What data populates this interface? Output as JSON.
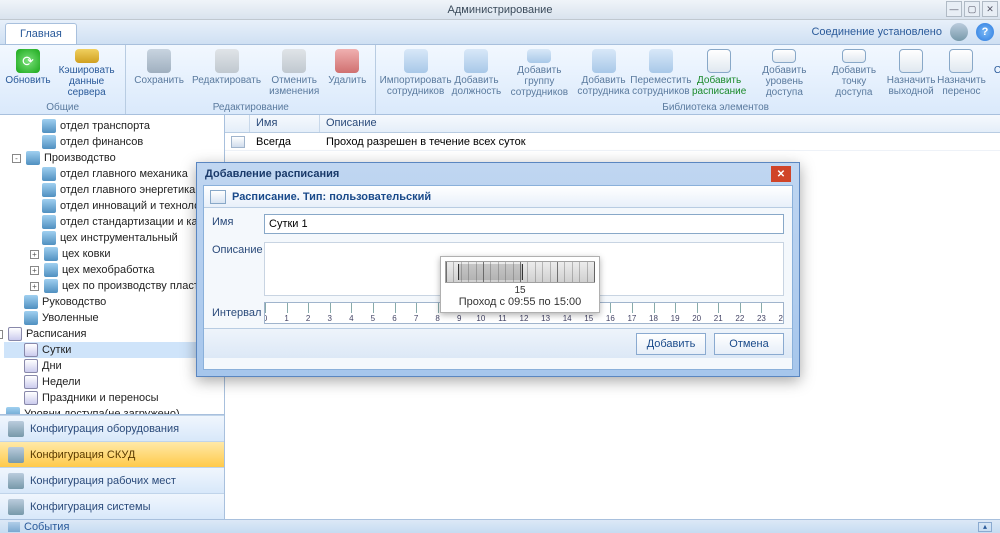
{
  "window": {
    "title": "Администрирование"
  },
  "tabs": {
    "main": "Главная"
  },
  "connection": {
    "status": "Соединение установлено"
  },
  "ribbon": {
    "groups": {
      "common": "Общие",
      "editing": "Редактирование",
      "library": "Библиотека элементов"
    },
    "buttons": {
      "refresh": "Обновить",
      "cache": "Кэшировать\nданные сервера",
      "save": "Сохранить",
      "edit": "Редактировать",
      "undo": "Отменить\nизменения",
      "delete": "Удалить",
      "import": "Импортировать\nсотрудников",
      "addPosition": "Добавить\nдолжность",
      "addGroup": "Добавить группу\nсотрудников",
      "addEmployee": "Добавить\nсотрудника",
      "moveEmployee": "Переместить\nсотрудников",
      "addSchedule": "Добавить\nрасписание",
      "addAccessLevel": "Добавить\nуровень доступа",
      "addAccessPoint": "Добавить\nточку доступа",
      "setDayOff": "Назначить\nвыходной",
      "setTransfer": "Назначить\nперенос",
      "apState": "Состояние\nточек доступа"
    }
  },
  "tree": {
    "items": [
      {
        "label": "отдел транспорта",
        "indent": 1,
        "icon": "ppl"
      },
      {
        "label": "отдел финансов",
        "indent": 1,
        "icon": "ppl"
      },
      {
        "label": "Производство",
        "indent": 0,
        "icon": "ppl",
        "exp": "-"
      },
      {
        "label": "отдел главного механика",
        "indent": 1,
        "icon": "ppl"
      },
      {
        "label": "отдел главного энергетика",
        "indent": 1,
        "icon": "ppl"
      },
      {
        "label": "отдел инноваций и технологи",
        "indent": 1,
        "icon": "ppl"
      },
      {
        "label": "отдел стандартизации и каче",
        "indent": 1,
        "icon": "ppl"
      },
      {
        "label": "цех инструментальный",
        "indent": 1,
        "icon": "ppl"
      },
      {
        "label": "цех ковки",
        "indent": 1,
        "icon": "ppl",
        "exp": "+"
      },
      {
        "label": "цех мехобработка",
        "indent": 1,
        "icon": "ppl",
        "exp": "+"
      },
      {
        "label": "цех по производству пластик",
        "indent": 1,
        "icon": "ppl",
        "exp": "+"
      },
      {
        "label": "Руководство",
        "indent": 0,
        "icon": "ppl"
      },
      {
        "label": "Уволенные",
        "indent": 0,
        "icon": "ppl"
      },
      {
        "label": "Расписания",
        "indent": -1,
        "icon": "cal",
        "exp": "-"
      },
      {
        "label": "Сутки",
        "indent": 0,
        "icon": "cal",
        "sel": true
      },
      {
        "label": "Дни",
        "indent": 0,
        "icon": "cal"
      },
      {
        "label": "Недели",
        "indent": 0,
        "icon": "cal"
      },
      {
        "label": "Праздники и переносы",
        "indent": 0,
        "icon": "cal"
      },
      {
        "label": "Уровни доступа(не загружено)",
        "indent": -1,
        "icon": "ppl"
      }
    ]
  },
  "nav": {
    "hardware": "Конфигурация оборудования",
    "skud": "Конфигурация СКУД",
    "workplaces": "Конфигурация рабочих мест",
    "system": "Конфигурация системы"
  },
  "grid": {
    "colName": "Имя",
    "colDesc": "Описание",
    "row": {
      "name": "Всегда",
      "desc": "Проход разрешен в течение всех суток"
    }
  },
  "dialog": {
    "title": "Добавление расписания",
    "header": "Расписание.  Тип: пользовательский",
    "labelName": "Имя",
    "valueName": "Сутки 1",
    "labelDesc": "Описание",
    "labelInterval": "Интервал",
    "btnAdd": "Добавить",
    "btnCancel": "Отмена",
    "interval": {
      "from": 9.92,
      "to": 15.0,
      "max": 24
    }
  },
  "tooltip": {
    "center": "15",
    "text": "Проход с 09:55 по 15:00"
  },
  "bottom": {
    "events": "События"
  }
}
